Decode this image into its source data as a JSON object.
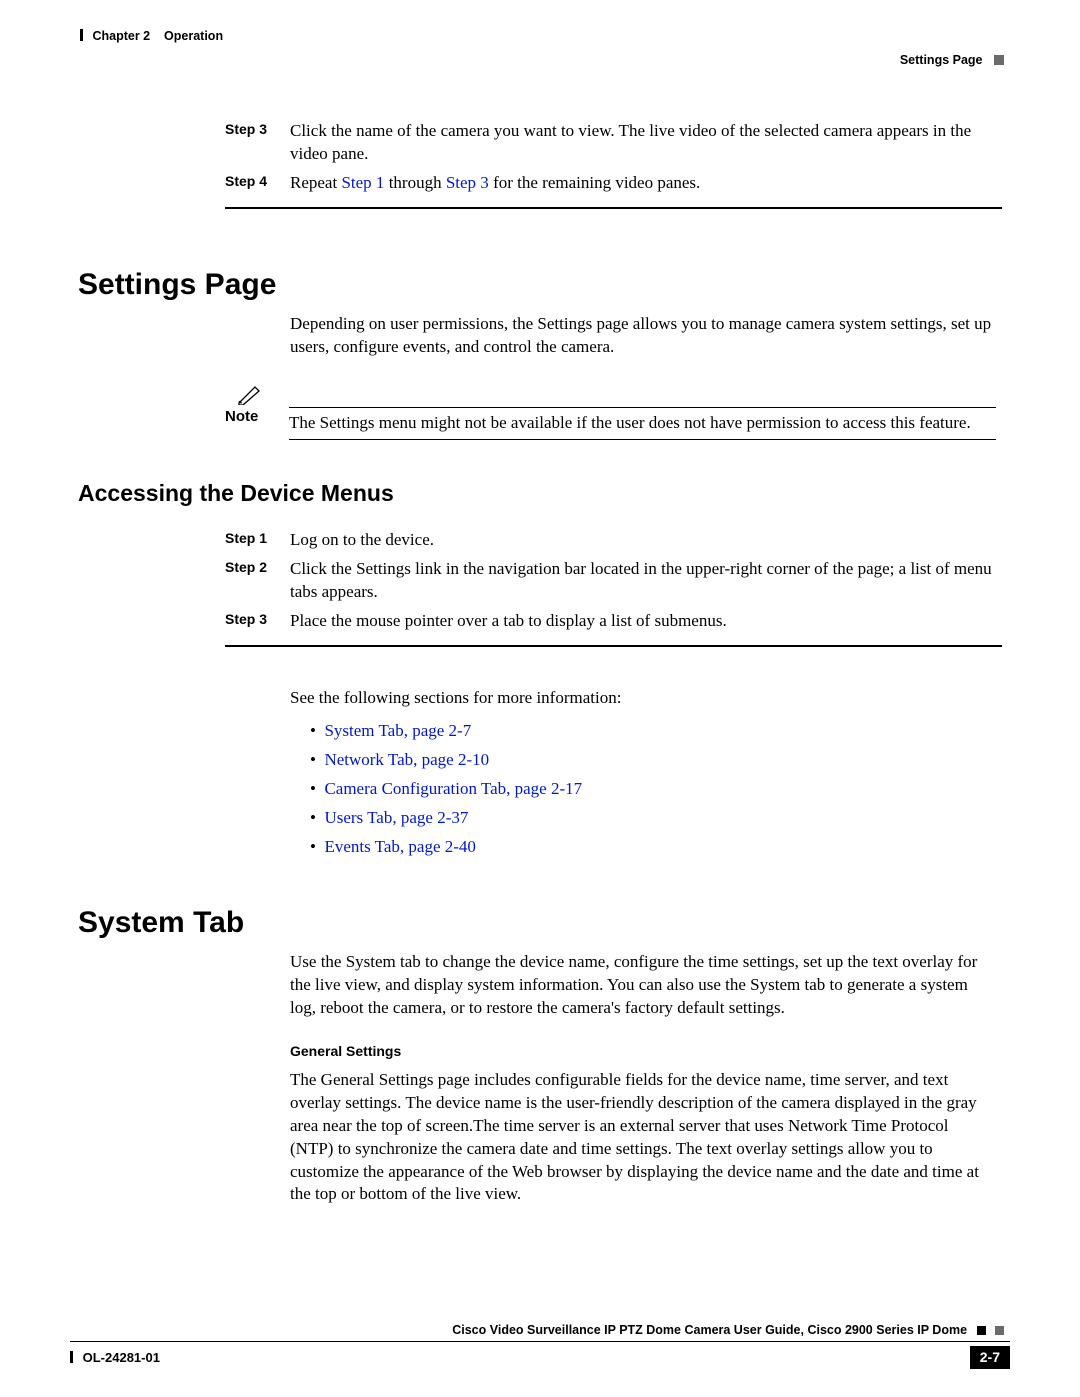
{
  "header": {
    "chapter_label": "Chapter 2",
    "chapter_title": "Operation",
    "section_breadcrumb": "Settings Page"
  },
  "steps_block_1": {
    "items": [
      {
        "label": "Step 3",
        "text": "Click the name of the camera you want to view. The live video of the selected camera appears in the video pane."
      },
      {
        "label": "Step 4",
        "text_parts": [
          "Repeat ",
          "Step 1",
          " through ",
          "Step 3",
          " for the remaining video panes."
        ]
      }
    ]
  },
  "settings_page": {
    "heading": "Settings Page",
    "intro": "Depending on user permissions, the Settings page allows you to manage camera system settings, set up users, configure events, and control the camera.",
    "note_label": "Note",
    "note_text": "The Settings menu might not be available if the user does not have permission to access this feature."
  },
  "accessing": {
    "heading": "Accessing the Device Menus",
    "steps": [
      {
        "label": "Step 1",
        "text": "Log on to the device."
      },
      {
        "label": "Step 2",
        "text": "Click the Settings link in the navigation bar located in the upper-right corner of the page; a list of menu tabs appears."
      },
      {
        "label": "Step 3",
        "text": "Place the mouse pointer over a tab to display a list of submenus."
      }
    ],
    "more_info": "See the following sections for more information:",
    "links": [
      "System Tab, page 2-7",
      "Network Tab, page 2-10",
      "Camera Configuration Tab, page 2-17",
      "Users Tab, page 2-37",
      "Events Tab, page 2-40"
    ]
  },
  "system_tab": {
    "heading": "System Tab",
    "intro": "Use the System tab to change the device name, configure the time settings, set up the text overlay for the live view, and display system information. You can also use the System tab to generate a system log, reboot the camera, or to restore the camera's factory default settings.",
    "general_heading": "General Settings",
    "general_body": "The General Settings page includes configurable fields for the device name, time server, and text overlay settings. The device name is the user-friendly description of the camera displayed in the gray area near the top of screen.The time server is an external server that uses Network Time Protocol (NTP) to synchronize the camera date and time settings. The text overlay settings allow you to customize the appearance of the Web browser by displaying the device name and the date and time at the top or bottom of the live view."
  },
  "footer": {
    "doc_title": "Cisco Video Surveillance IP PTZ Dome Camera User Guide, Cisco 2900 Series IP Dome",
    "doc_id": "OL-24281-01",
    "page_number": "2-7"
  }
}
